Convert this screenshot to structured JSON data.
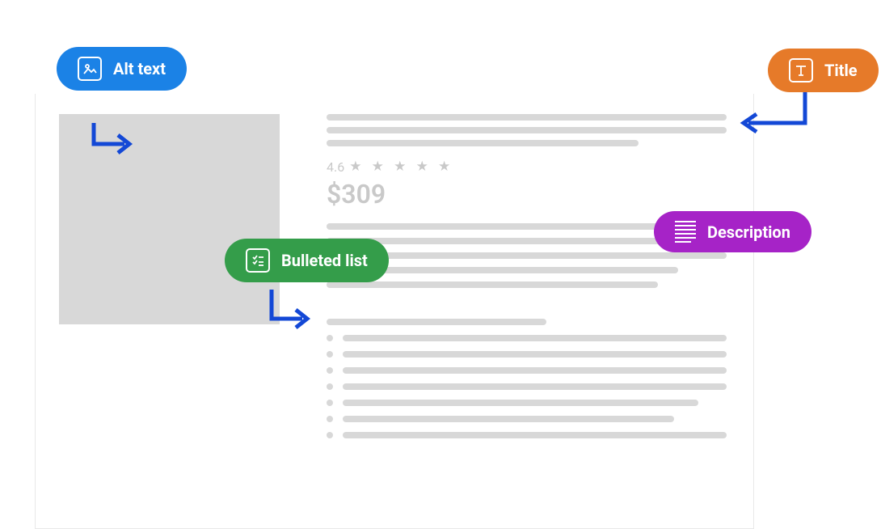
{
  "badges": {
    "alt_text": "Alt text",
    "title": "Title",
    "bulleted_list": "Bulleted list",
    "description": "Description"
  },
  "product": {
    "rating_value": "4.6",
    "rating_stars": "★ ★ ★ ★ ★",
    "price": "$309"
  },
  "colors": {
    "blue": "#1b82e6",
    "orange": "#e67a29",
    "green": "#349d4a",
    "purple": "#a623c7",
    "gray": "#d8d8d8",
    "arrow": "#1348d6"
  }
}
